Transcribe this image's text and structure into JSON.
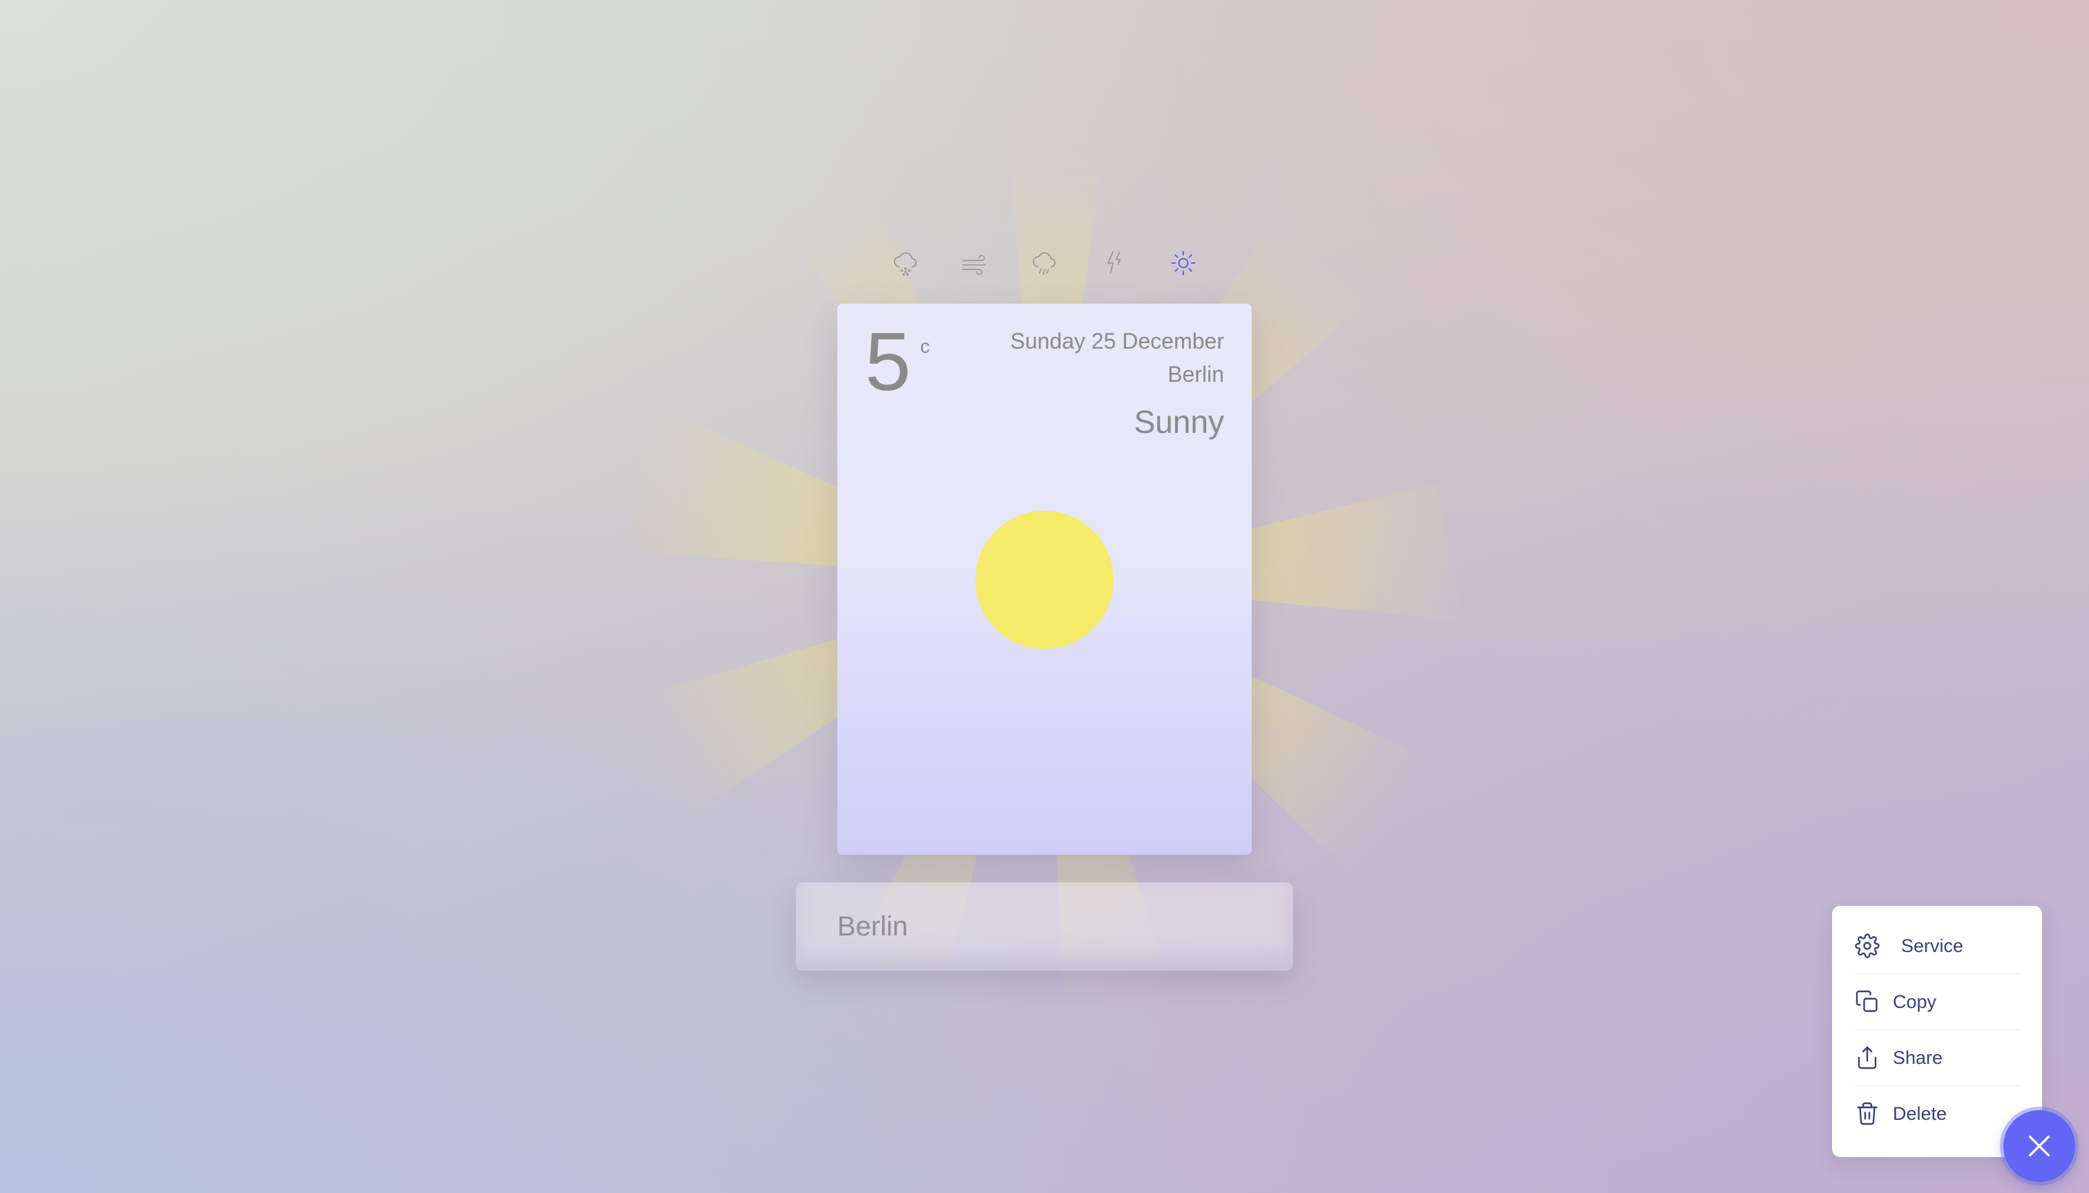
{
  "weather_types": {
    "items": [
      {
        "name": "snow",
        "icon": "snow-cloud-icon",
        "active": false
      },
      {
        "name": "wind",
        "icon": "wind-icon",
        "active": false
      },
      {
        "name": "rain",
        "icon": "rain-cloud-icon",
        "active": false
      },
      {
        "name": "thunder",
        "icon": "lightning-icon",
        "active": false
      },
      {
        "name": "sun",
        "icon": "sun-icon",
        "active": true
      }
    ],
    "active_color": "#5b5ee8",
    "inactive_color": "#9a9a9a"
  },
  "card": {
    "temperature": "5",
    "unit": "c",
    "date": "Sunday 25 December",
    "city": "Berlin",
    "condition": "Sunny",
    "sun_color": "#f5ec69"
  },
  "search": {
    "value": "Berlin"
  },
  "menu": {
    "items": [
      {
        "label": "Service",
        "icon": "gear-icon"
      },
      {
        "label": "Copy",
        "icon": "copy-icon"
      },
      {
        "label": "Share",
        "icon": "share-icon"
      },
      {
        "label": "Delete",
        "icon": "trash-icon"
      }
    ],
    "text_color": "#3b3f7a"
  },
  "fab": {
    "icon": "close-icon",
    "color": "#6166f4"
  }
}
